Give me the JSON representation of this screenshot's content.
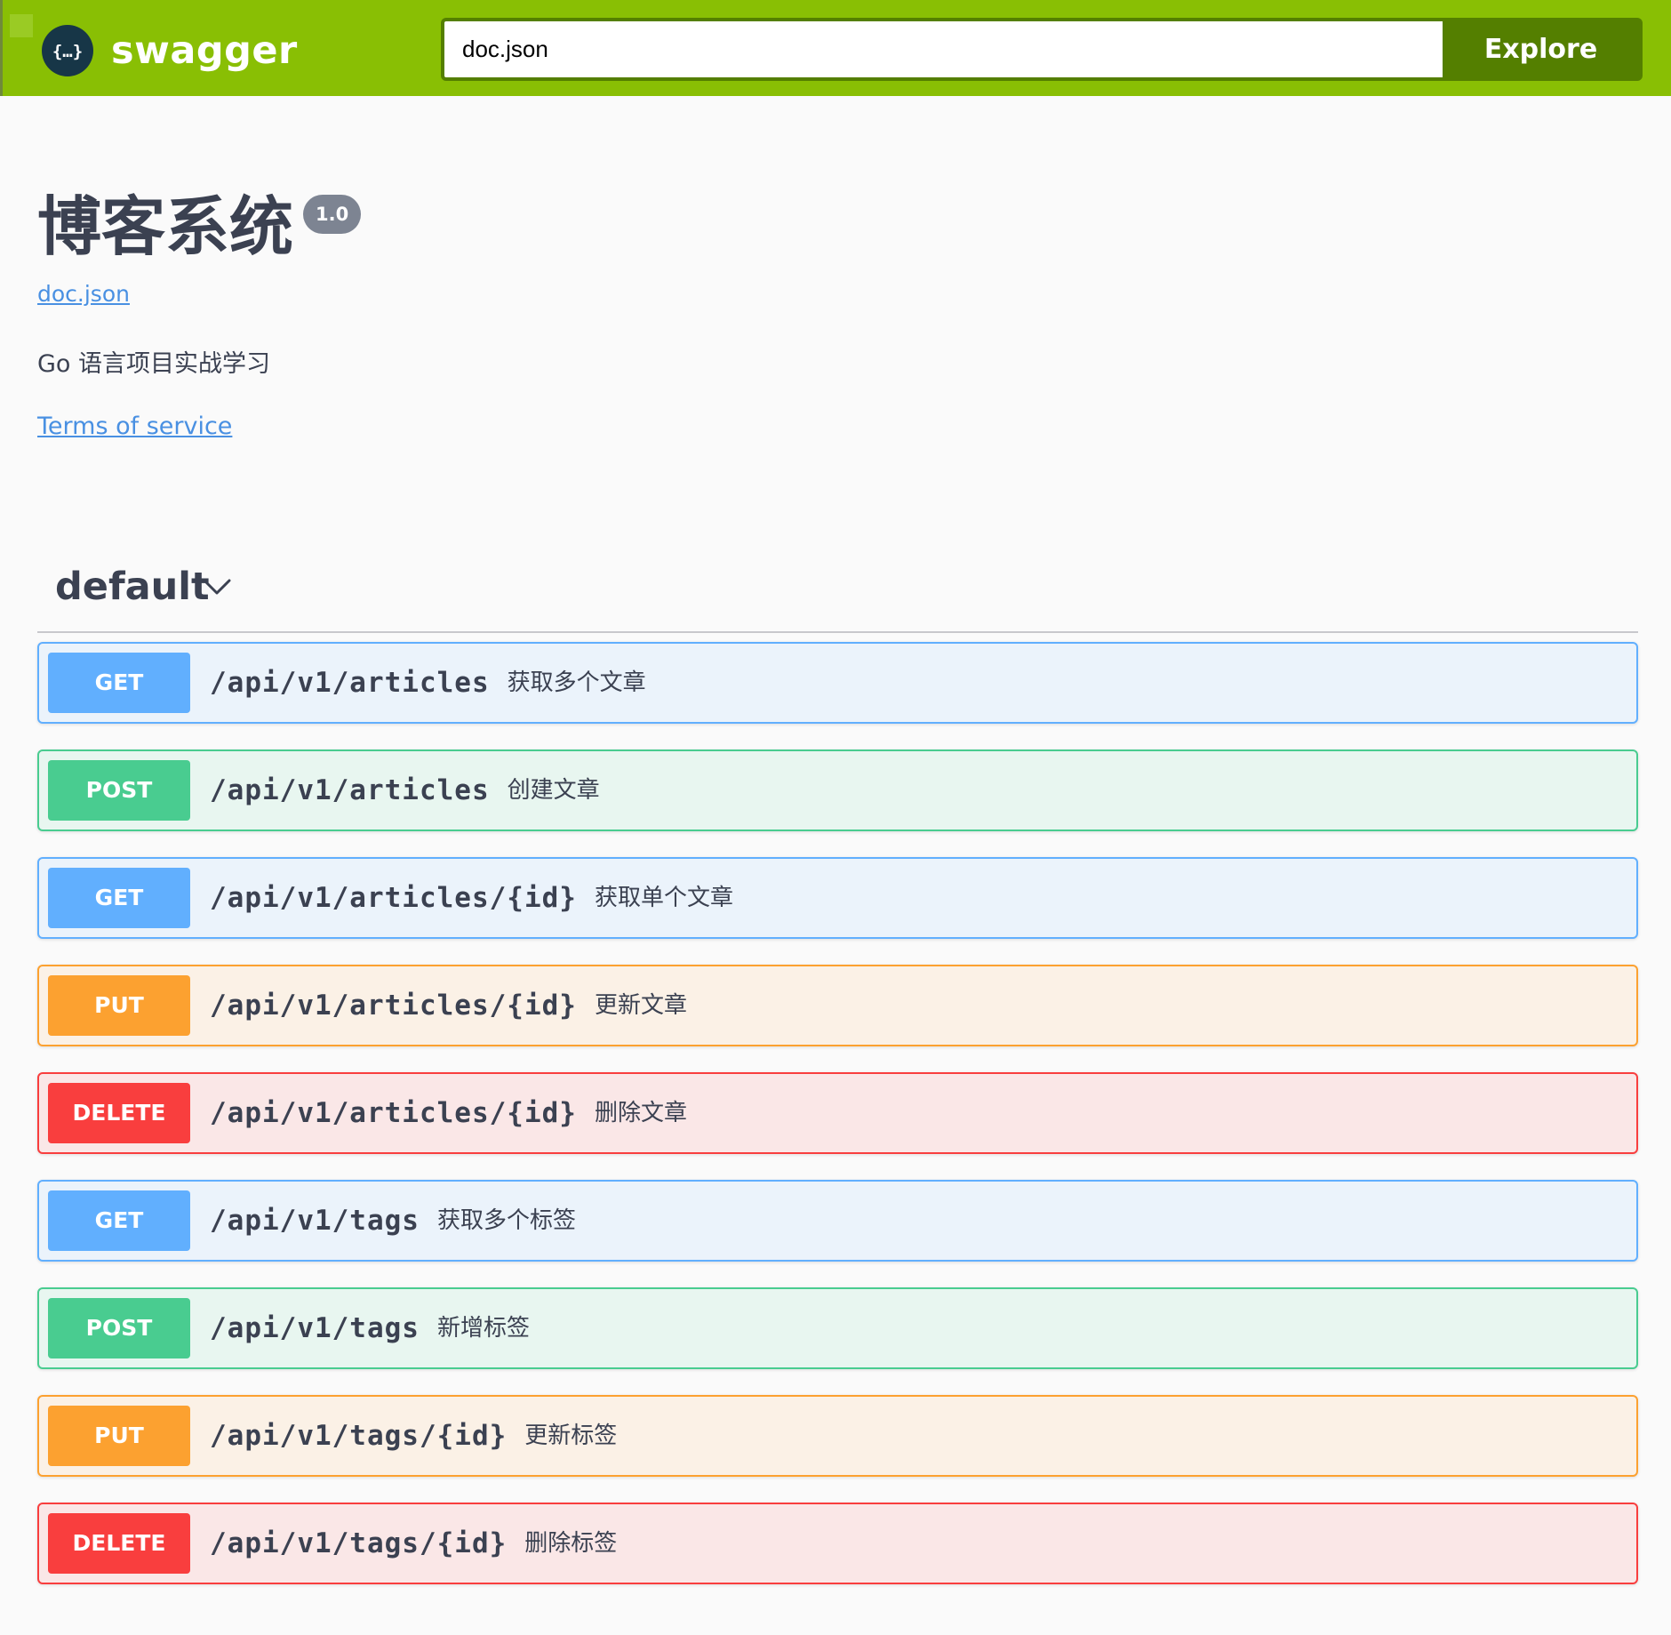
{
  "topbar": {
    "brand": "swagger",
    "url_value": "doc.json",
    "explore_label": "Explore",
    "accent_color": "#89bf04",
    "button_color": "#547f00"
  },
  "info": {
    "title": "博客系统",
    "version": "1.0",
    "spec_link": "doc.json",
    "description": "Go 语言项目实战学习",
    "terms_link": "Terms of service"
  },
  "tag": {
    "name": "default",
    "expanded": true
  },
  "operations": [
    {
      "method": "GET",
      "path": "/api/v1/articles",
      "summary": "获取多个文章"
    },
    {
      "method": "POST",
      "path": "/api/v1/articles",
      "summary": "创建文章"
    },
    {
      "method": "GET",
      "path": "/api/v1/articles/{id}",
      "summary": "获取单个文章"
    },
    {
      "method": "PUT",
      "path": "/api/v1/articles/{id}",
      "summary": "更新文章"
    },
    {
      "method": "DELETE",
      "path": "/api/v1/articles/{id}",
      "summary": "删除文章"
    },
    {
      "method": "GET",
      "path": "/api/v1/tags",
      "summary": "获取多个标签"
    },
    {
      "method": "POST",
      "path": "/api/v1/tags",
      "summary": "新增标签"
    },
    {
      "method": "PUT",
      "path": "/api/v1/tags/{id}",
      "summary": "更新标签"
    },
    {
      "method": "DELETE",
      "path": "/api/v1/tags/{id}",
      "summary": "删除标签"
    }
  ],
  "method_colors": {
    "GET": "#61affe",
    "POST": "#49cc90",
    "PUT": "#fca130",
    "DELETE": "#f93e3e"
  }
}
